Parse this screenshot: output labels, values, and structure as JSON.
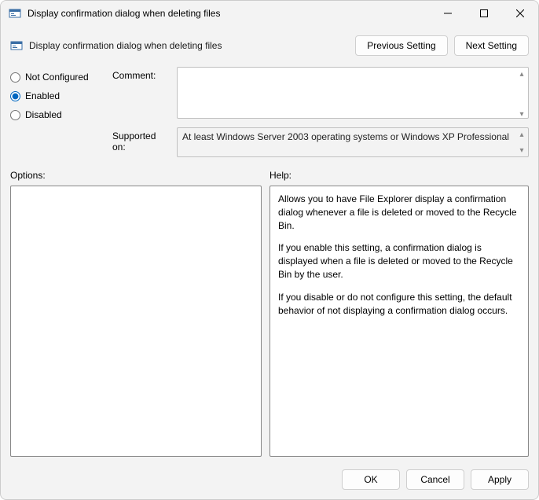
{
  "window": {
    "title": "Display confirmation dialog when deleting files"
  },
  "header": {
    "subtitle": "Display confirmation dialog when deleting files",
    "prev_label": "Previous Setting",
    "next_label": "Next Setting"
  },
  "radios": {
    "not_configured": "Not Configured",
    "enabled": "Enabled",
    "disabled": "Disabled",
    "selected": "enabled"
  },
  "meta": {
    "comment_label": "Comment:",
    "comment_value": "",
    "supported_label": "Supported on:",
    "supported_value": "At least Windows Server 2003 operating systems or Windows XP Professional"
  },
  "sections": {
    "options_label": "Options:",
    "help_label": "Help:"
  },
  "help": {
    "p1": "Allows you to have File Explorer display a confirmation dialog whenever a file is deleted or moved to the Recycle Bin.",
    "p2": "If you enable this setting, a confirmation dialog is displayed when a file is deleted or moved to the Recycle Bin by the user.",
    "p3": "If you disable or do not configure this setting, the default behavior of not displaying a confirmation dialog occurs."
  },
  "footer": {
    "ok": "OK",
    "cancel": "Cancel",
    "apply": "Apply"
  }
}
